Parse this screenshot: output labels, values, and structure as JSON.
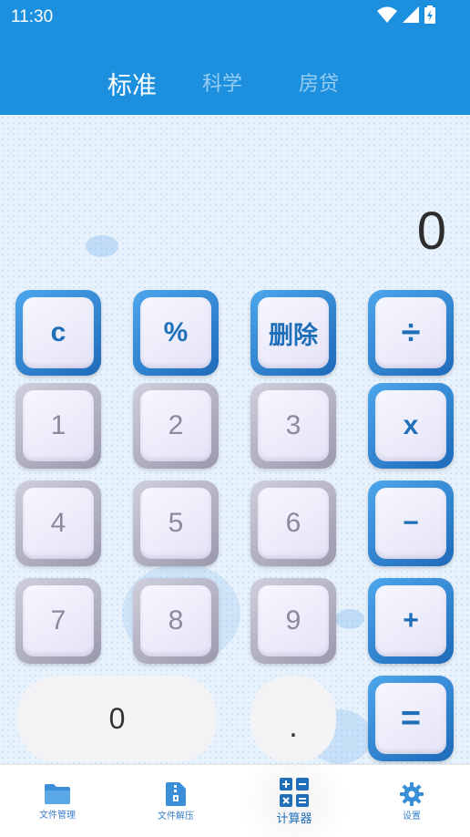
{
  "status_bar": {
    "time": "11:30"
  },
  "tabs": [
    {
      "label": "标准",
      "active": true
    },
    {
      "label": "科学",
      "active": false
    },
    {
      "label": "房贷",
      "active": false
    }
  ],
  "display": {
    "value": "0"
  },
  "keys": {
    "clear": "c",
    "percent": "%",
    "delete": "删除",
    "divide": "÷",
    "one": "1",
    "two": "2",
    "three": "3",
    "multiply": "x",
    "four": "4",
    "five": "5",
    "six": "6",
    "minus": "−",
    "seven": "7",
    "eight": "8",
    "nine": "9",
    "plus": "+",
    "zero": "0",
    "dot": ".",
    "equals": "="
  },
  "bottom_nav": [
    {
      "label": "文件管理",
      "icon": "folder-icon"
    },
    {
      "label": "文件解压",
      "icon": "zip-file-icon"
    },
    {
      "label": "计算器",
      "icon": "calculator-icon",
      "active": true
    },
    {
      "label": "设置",
      "icon": "gear-icon"
    }
  ],
  "colors": {
    "header": "#1c90de",
    "accent_blue": "#1e6fb8",
    "nav_icon": "#3a8fd8"
  }
}
